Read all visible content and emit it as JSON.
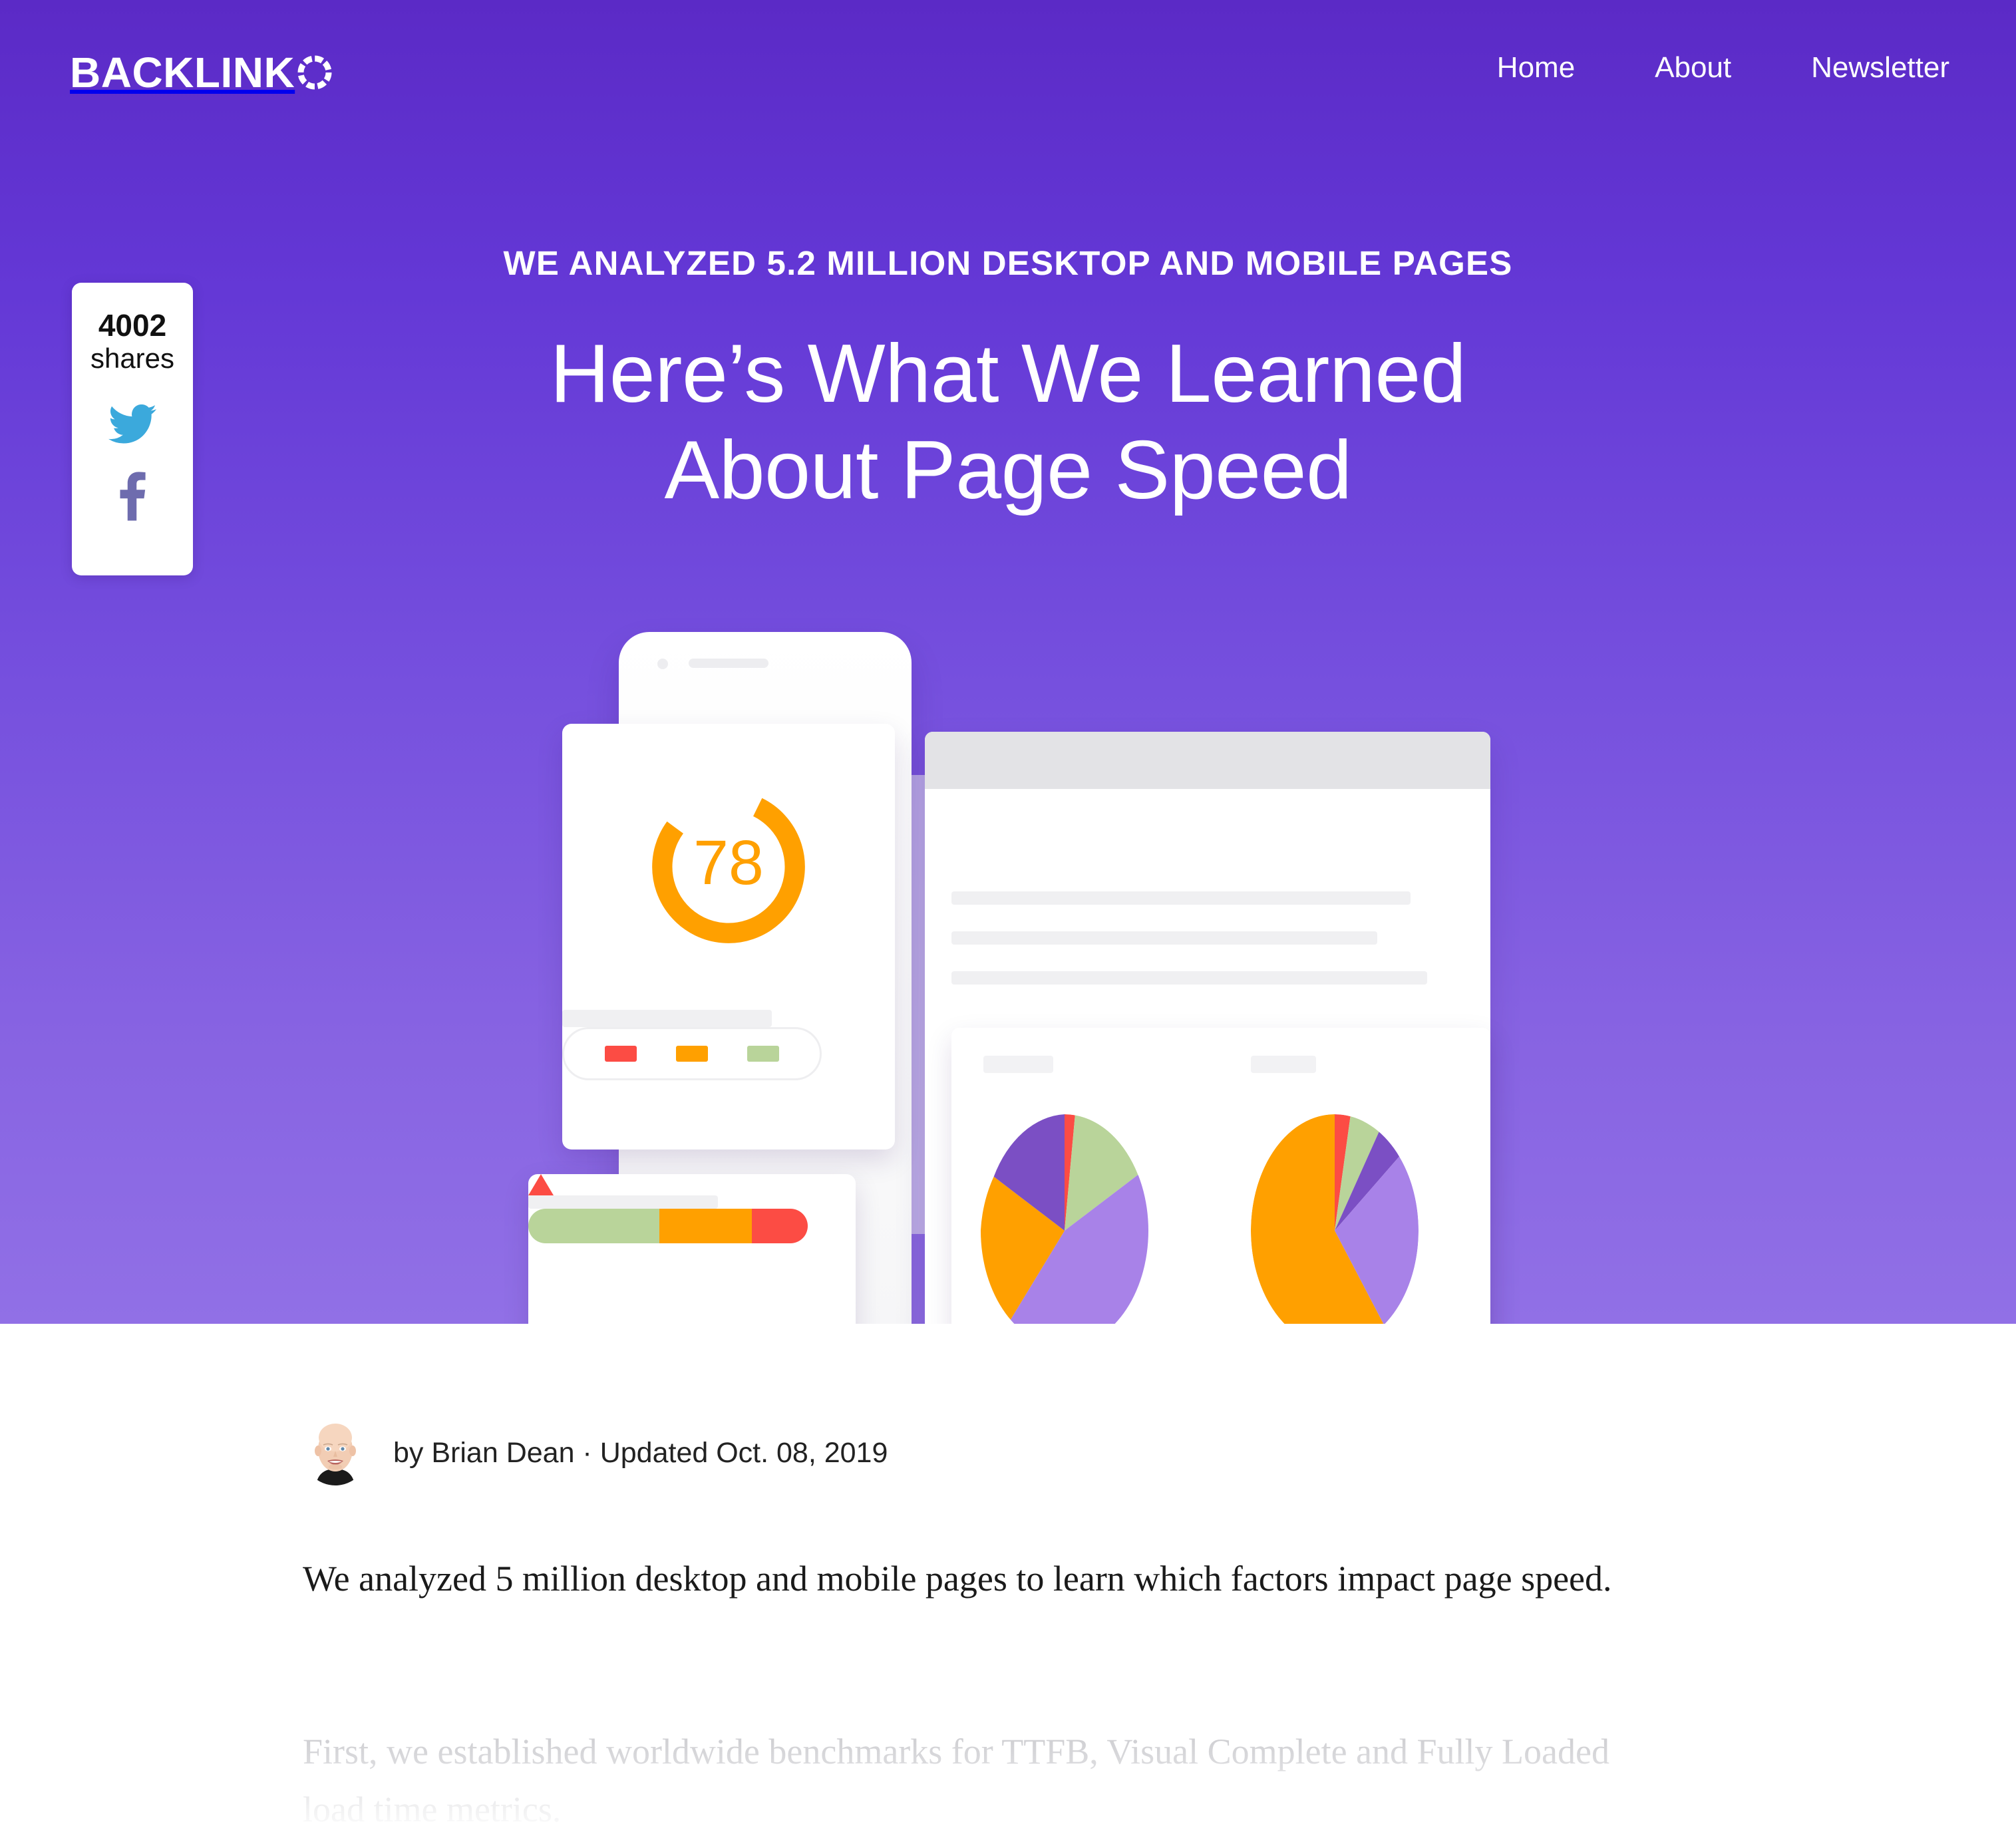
{
  "site": {
    "logo_text": "BACKLINK",
    "logo_ring_icon": "segmented-ring-icon",
    "brand_purple_top": "#5B2AC6",
    "brand_purple_bottom": "#9170E6"
  },
  "nav": {
    "items": [
      {
        "label": "Home"
      },
      {
        "label": "About"
      },
      {
        "label": "Newsletter"
      }
    ]
  },
  "share": {
    "count": "4002",
    "label": "shares",
    "twitter_icon": "twitter-bird-icon",
    "twitter_color": "#3BA9DC",
    "facebook_icon": "facebook-f-icon",
    "facebook_color": "#6E6CAE"
  },
  "hero": {
    "eyebrow": "WE ANALYZED 5.2 MILLION DESKTOP AND MOBILE PAGES",
    "headline_line1": "Here’s What We Learned",
    "headline_line2": "About Page Speed"
  },
  "illustration": {
    "gauge": {
      "value": "78",
      "value_color": "#FFA000",
      "track_color": "#FFA000",
      "sweep_percent": 78
    },
    "legend_swatches": [
      {
        "name": "poor",
        "color": "#FC4C44"
      },
      {
        "name": "average",
        "color": "#FFA000"
      },
      {
        "name": "good",
        "color": "#B9D49A"
      }
    ],
    "warning_icon": "warning-triangle-icon",
    "warning_color": "#FC4C44",
    "progress_bar": {
      "segments": [
        {
          "name": "good",
          "color": "#B9D49A",
          "percent": 47
        },
        {
          "name": "average",
          "color": "#FFA000",
          "percent": 33
        },
        {
          "name": "poor",
          "color": "#FC4C44",
          "percent": 20
        }
      ]
    }
  },
  "chart_data": [
    {
      "type": "pie",
      "title": "",
      "name": "desktop-pie",
      "labels": [
        "Red",
        "Light Green",
        "Light Purple",
        "Orange",
        "Dark Purple"
      ],
      "values": [
        2,
        15,
        45,
        22,
        16
      ],
      "colors": [
        "#FC4C44",
        "#B9D49A",
        "#A882E8",
        "#FFA000",
        "#7B4FC4"
      ],
      "legend": "none"
    },
    {
      "type": "pie",
      "title": "",
      "name": "mobile-pie",
      "labels": [
        "Red",
        "Light Green",
        "Dark Purple",
        "Light Purple",
        "Orange"
      ],
      "values": [
        3,
        6,
        5,
        26,
        60
      ],
      "colors": [
        "#FC4C44",
        "#B9D49A",
        "#7B4FC4",
        "#A882E8",
        "#FFA000"
      ],
      "legend": "none"
    }
  ],
  "article": {
    "author_prefix": "by",
    "byline": "by Brian Dean · Updated Oct. 08, 2019",
    "avatar_icon": "author-avatar",
    "paragraph_1": "We analyzed 5 million desktop and mobile pages to learn which factors impact page speed.",
    "paragraph_2": "First, we established worldwide benchmarks for TTFB, Visual Complete and Fully Loaded load time metrics."
  }
}
